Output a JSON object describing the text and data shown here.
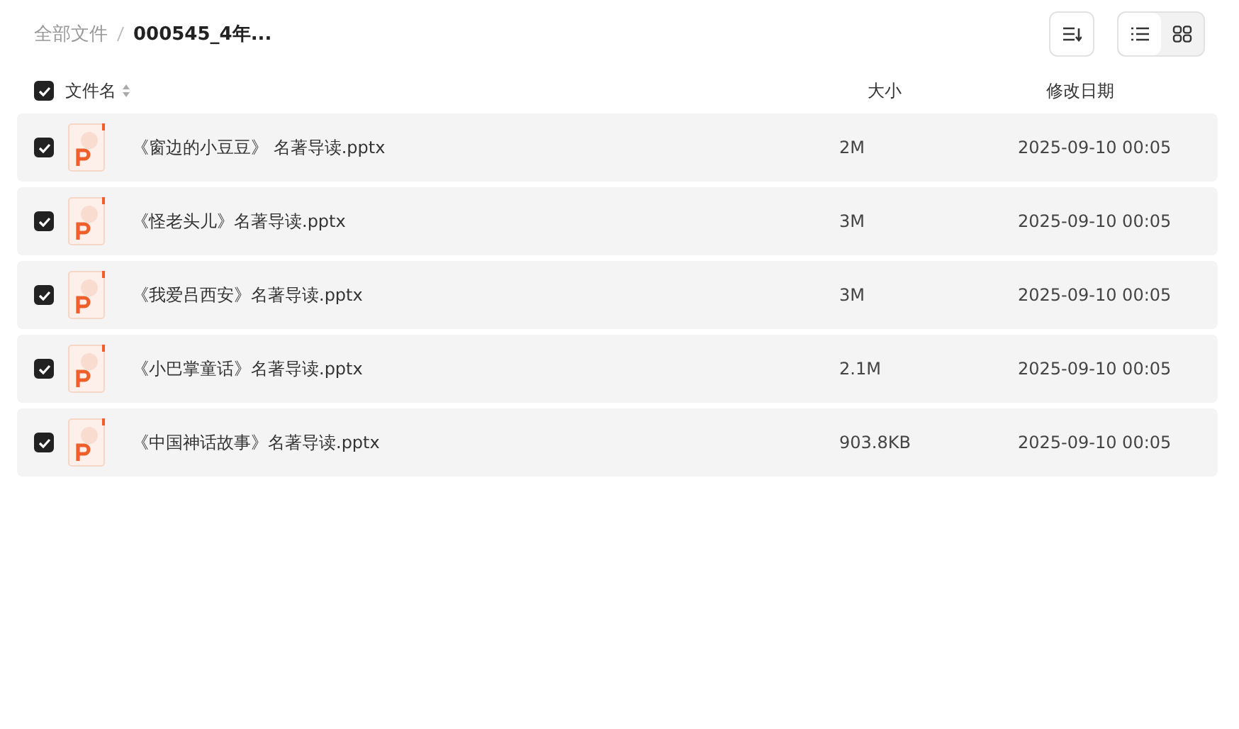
{
  "breadcrumb": [
    {
      "label": "全部文件",
      "current": false
    },
    {
      "label": "000545_4年...",
      "current": true
    }
  ],
  "view_modes": [
    {
      "kind": "list",
      "selected": true
    },
    {
      "kind": "grid",
      "selected": false
    }
  ],
  "header": {
    "all_checked": true,
    "columns": [
      "文件名",
      "大小",
      "修改日期"
    ]
  },
  "files": [
    {
      "name": "《窗边的小豆豆》 名著导读.pptx",
      "size": "2M",
      "modified": "2025-09-10 00:05",
      "checked": true
    },
    {
      "name": "《怪老头儿》名著导读.pptx",
      "size": "3M",
      "modified": "2025-09-10 00:05",
      "checked": true
    },
    {
      "name": "《我爱吕西安》名著导读.pptx",
      "size": "3M",
      "modified": "2025-09-10 00:05",
      "checked": true
    },
    {
      "name": "《小巴掌童话》名著导读.pptx",
      "size": "2.1M",
      "modified": "2025-09-10 00:05",
      "checked": true
    },
    {
      "name": "《中国神话故事》名著导读.pptx",
      "size": "903.8KB",
      "modified": "2025-09-10 00:05",
      "checked": true
    }
  ]
}
